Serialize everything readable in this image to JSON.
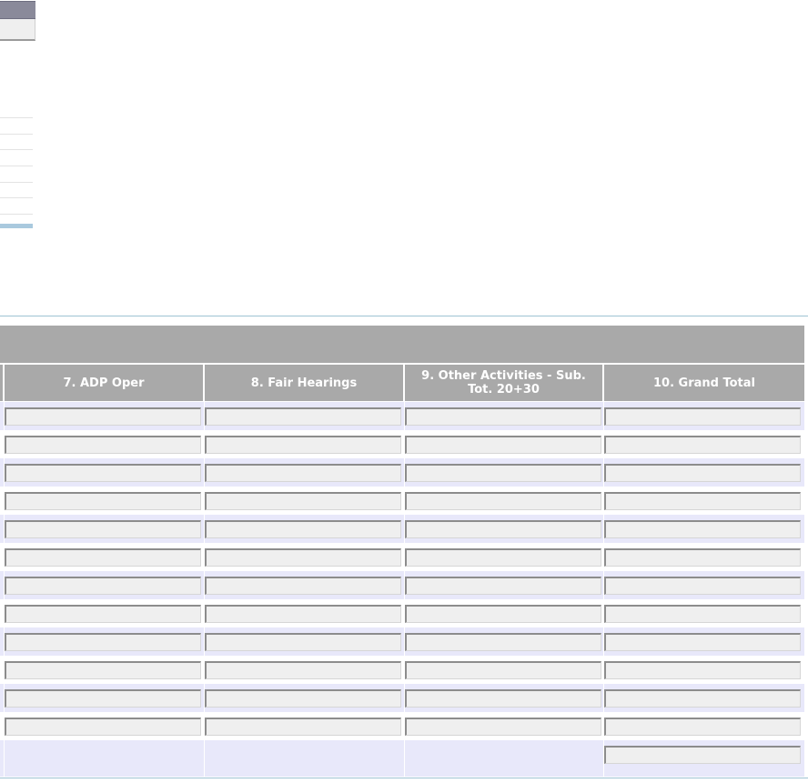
{
  "table": {
    "columns": [
      {
        "label": "7. ADP Oper"
      },
      {
        "label": "8. Fair Hearings"
      },
      {
        "label": "9. Other Activities - Sub. Tot. 20+30"
      },
      {
        "label": "10. Grand Total"
      }
    ],
    "rows": [
      {
        "values": [
          "",
          "",
          "",
          ""
        ]
      },
      {
        "values": [
          "",
          "",
          "",
          ""
        ]
      },
      {
        "values": [
          "",
          "",
          "",
          ""
        ]
      },
      {
        "values": [
          "",
          "",
          "",
          ""
        ]
      },
      {
        "values": [
          "",
          "",
          "",
          ""
        ]
      },
      {
        "values": [
          "",
          "",
          "",
          ""
        ]
      },
      {
        "values": [
          "",
          "",
          "",
          ""
        ]
      },
      {
        "values": [
          "",
          "",
          "",
          ""
        ]
      },
      {
        "values": [
          "",
          "",
          "",
          ""
        ]
      },
      {
        "values": [
          "",
          "",
          "",
          ""
        ]
      },
      {
        "values": [
          "",
          "",
          "",
          ""
        ]
      },
      {
        "values": [
          "",
          "",
          "",
          ""
        ]
      }
    ],
    "total": {
      "grand_total": ""
    }
  },
  "colors": {
    "header_bg": "#a9a9a9",
    "row_alt_bg": "#e8e8fa",
    "rule": "#9ec3d3",
    "field_bg": "#efefef"
  }
}
